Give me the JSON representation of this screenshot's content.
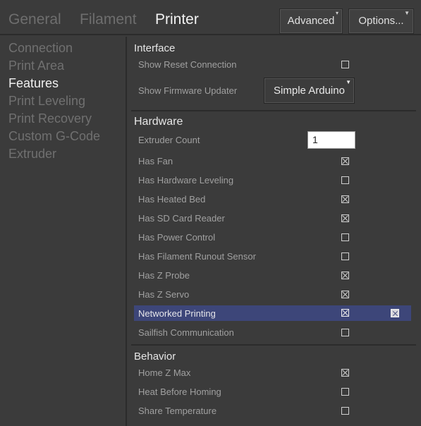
{
  "tabs": [
    {
      "label": "General"
    },
    {
      "label": "Filament"
    },
    {
      "label": "Printer",
      "active": true
    }
  ],
  "toolbar": {
    "advanced_label": "Advanced",
    "options_label": "Options..."
  },
  "nav": {
    "items": [
      {
        "label": "Connection"
      },
      {
        "label": "Print Area"
      },
      {
        "label": "Features",
        "active": true
      },
      {
        "label": "Print Leveling"
      },
      {
        "label": "Print Recovery"
      },
      {
        "label": "Custom G-Code"
      },
      {
        "label": "Extruder"
      }
    ]
  },
  "interface": {
    "title": "Interface",
    "show_reset_connection": {
      "label": "Show Reset Connection",
      "checked": false
    },
    "show_firmware_updater": {
      "label": "Show Firmware Updater",
      "value": "Simple Arduino"
    }
  },
  "hardware": {
    "title": "Hardware",
    "extruder_count": {
      "label": "Extruder Count",
      "value": "1"
    },
    "rows": [
      {
        "label": "Has Fan",
        "checked": true
      },
      {
        "label": "Has Hardware Leveling",
        "checked": false
      },
      {
        "label": "Has Heated Bed",
        "checked": true
      },
      {
        "label": "Has SD Card Reader",
        "checked": true
      },
      {
        "label": "Has Power Control",
        "checked": false
      },
      {
        "label": "Has Filament Runout Sensor",
        "checked": false
      },
      {
        "label": "Has Z Probe",
        "checked": true
      },
      {
        "label": "Has Z Servo",
        "checked": true
      },
      {
        "label": "Networked Printing",
        "checked": true,
        "highlighted": true
      },
      {
        "label": "Sailfish Communication",
        "checked": false
      }
    ]
  },
  "behavior": {
    "title": "Behavior",
    "rows": [
      {
        "label": "Home Z Max",
        "checked": true
      },
      {
        "label": "Heat Before Homing",
        "checked": false
      },
      {
        "label": "Share Temperature",
        "checked": false
      }
    ]
  },
  "colors": {
    "background": "#3b3b3b",
    "highlight": "#3d4679",
    "active_text": "#f0f0f0",
    "inactive_text": "#707070"
  }
}
